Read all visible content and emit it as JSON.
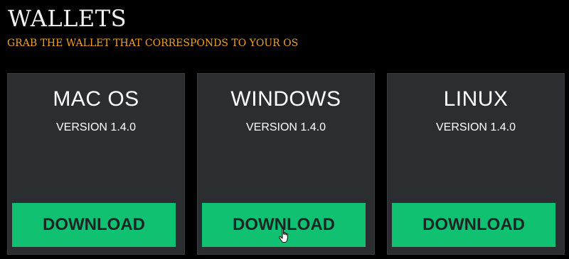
{
  "header": {
    "title": "WALLETS",
    "subtitle": "GRAB THE WALLET THAT CORRESPONDS TO YOUR OS"
  },
  "cards": [
    {
      "os": "MAC OS",
      "version": "VERSION 1.4.0",
      "button": "DOWNLOAD"
    },
    {
      "os": "WINDOWS",
      "version": "VERSION 1.4.0",
      "button": "DOWNLOAD"
    },
    {
      "os": "LINUX",
      "version": "VERSION 1.4.0",
      "button": "DOWNLOAD"
    }
  ],
  "colors": {
    "background": "#000000",
    "card": "#2b2e30",
    "accent": "#10c172",
    "subtitle": "#f6a01a"
  },
  "icons": {
    "cursor": "hand-pointer-icon"
  }
}
